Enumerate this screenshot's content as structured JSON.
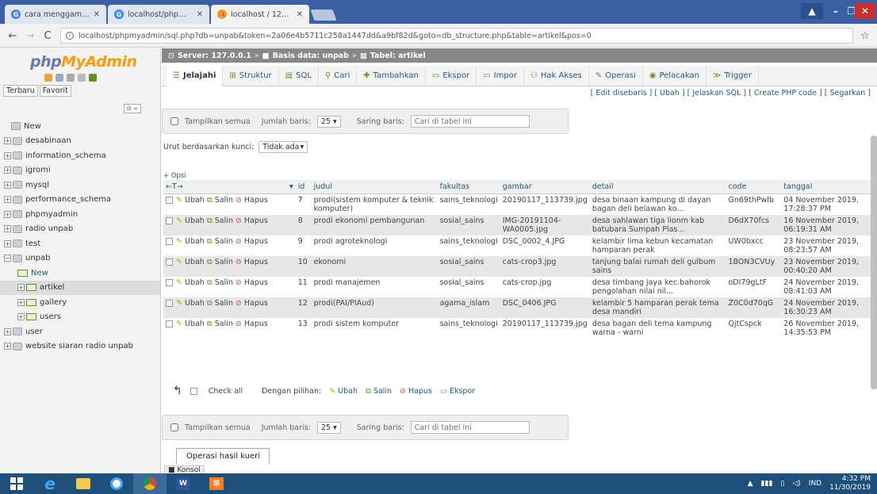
{
  "browser": {
    "tabs": [
      {
        "title": "cara menggambar lem - G...",
        "favicon": "google-icon",
        "active": false
      },
      {
        "title": "localhost/phpmyadmin - G",
        "favicon": "google-icon",
        "active": false
      },
      {
        "title": "localhost / 127.0.0.1 / ...",
        "favicon": "pma-icon",
        "active": true
      }
    ],
    "url": "localhost/phpmyadmin/sql.php?db=unpab&token=2a06e4b5711c258a1447dd&a9bf82d&goto=db_structure.php&table=artikel&pos=0"
  },
  "sidebar": {
    "logo_a": "php",
    "logo_b": "MyAdmin",
    "recent_label": "Terbaru",
    "favorite_label": "Favorit",
    "new_label": "New",
    "databases": [
      {
        "name": "desabinaan"
      },
      {
        "name": "information_schema"
      },
      {
        "name": "igromi"
      },
      {
        "name": "mysql"
      },
      {
        "name": "performance_schema"
      },
      {
        "name": "phpmyadmin"
      },
      {
        "name": "radio unpab"
      },
      {
        "name": "test"
      },
      {
        "name": "unpab"
      }
    ],
    "unpab_tables": [
      {
        "name": "New"
      },
      {
        "name": "artikel"
      },
      {
        "name": "gallery"
      },
      {
        "name": "users"
      }
    ],
    "more_databases": [
      {
        "name": "user"
      },
      {
        "name": "website siaran radio unpab"
      }
    ]
  },
  "breadcrumb": {
    "server": "Server: 127.0.0.1",
    "database": "Basis data: unpab",
    "table": "Tabel: artikel"
  },
  "menu": [
    {
      "label": "Jelajahi",
      "icon": "browse-icon"
    },
    {
      "label": "Struktur",
      "icon": "structure-icon"
    },
    {
      "label": "SQL",
      "icon": "sql-icon"
    },
    {
      "label": "Cari",
      "icon": "search-icon"
    },
    {
      "label": "Tambahkan",
      "icon": "insert-icon"
    },
    {
      "label": "Ekspor",
      "icon": "export-icon"
    },
    {
      "label": "Impor",
      "icon": "import-icon"
    },
    {
      "label": "Hak Akses",
      "icon": "privileges-icon"
    },
    {
      "label": "Operasi",
      "icon": "operations-icon"
    },
    {
      "label": "Pelacakan",
      "icon": "tracking-icon"
    },
    {
      "label": "Trigger",
      "icon": "trigger-icon"
    }
  ],
  "sublinks": "[ Edit disebaris ] [ Ubah ] [ Jelaskan SQL ] [ Create PHP code ] [ Segarkan ]",
  "nav": {
    "show_all": "Tampilkan semua",
    "rows_label": "Jumlah baris:",
    "rows_value": "25",
    "filter_label": "Saring baris:",
    "filter_placeholder": "Cari di tabel ini"
  },
  "sort": {
    "label": "Urut berdasarkan kunci:",
    "value": "Tidak ada"
  },
  "options_label": "+ Opsi",
  "columns": [
    "id",
    "judul",
    "fakultas",
    "gambar",
    "detail",
    "code",
    "tanggal"
  ],
  "actions": {
    "edit": "Ubah",
    "copy": "Salin",
    "delete": "Hapus"
  },
  "rows": [
    {
      "id": "7",
      "judul": "prodi(sistem komputer & teknik komputer)",
      "fakultas": "sains_teknologi",
      "gambar": "20190117_113739.jpg",
      "detail": "desa binaan kampung di dayan bagan deli belawan ko...",
      "code": "Gn69thPwlb",
      "tanggal": "04 November 2019, 17:28:37 PM"
    },
    {
      "id": "8",
      "judul": "prodi ekonomi pembangunan",
      "fakultas": "sosial_sains",
      "gambar": "IMG-20191104-WA0005.jpg",
      "detail": "desa sahlawan tiga lionm kab batubara Sumpah Plas...",
      "code": "D6dX70fcs",
      "tanggal": "16 November 2019, 06:19:31 AM"
    },
    {
      "id": "9",
      "judul": "prodi agroteknologi",
      "fakultas": "sains_teknologi",
      "gambar": "DSC_0002_4.JPG",
      "detail": "kelambir lima kebun kecamatan hamparan perak",
      "code": "UW0bxcc",
      "tanggal": "23 November 2019, 08:23:57 AM"
    },
    {
      "id": "10",
      "judul": "ekonomi",
      "fakultas": "sosial_sains",
      "gambar": "cats-crop3.jpg",
      "detail": "tanjung balai rumah deli gulbum sains",
      "code": "1BON3CVUy",
      "tanggal": "23 November 2019, 00:40:20 AM"
    },
    {
      "id": "11",
      "judul": "prodi manajemen",
      "fakultas": "sosial_sains",
      "gambar": "cats-crop.jpg",
      "detail": "desa timbang jaya kec.bahorok pengolahan nilai nil...",
      "code": "oDI79gLtF",
      "tanggal": "24 November 2019, 08:41:03 AM"
    },
    {
      "id": "12",
      "judul": "prodi(PAI/PIAud)",
      "fakultas": "agama_islam",
      "gambar": "DSC_0406.JPG",
      "detail": "kelambir 5 hamparan perak tema desa mandiri",
      "code": "Z0C0d70qG",
      "tanggal": "24 November 2019, 16:30:23 AM"
    },
    {
      "id": "13",
      "judul": "prodi sistem komputer",
      "fakultas": "sains_teknologi",
      "gambar": "20190117_113739.jpg",
      "detail": "desa bagan deli tema kampung warna - warni",
      "code": "QjtCspck",
      "tanggal": "26 November 2019, 14:35:53 PM"
    }
  ],
  "bulk": {
    "check_all": "Check all",
    "with_selected": "Dengan pilihan:",
    "edit": "Ubah",
    "copy": "Salin",
    "delete": "Hapus",
    "export": "Ekspor"
  },
  "result_ops": "Operasi hasil kueri",
  "console": "Konsol",
  "taskbar": {
    "lang": "IND",
    "time": "4:32 PM",
    "date": "11/30/2019"
  },
  "colors": {
    "tabstrip": "#3b5fa5",
    "taskbar": "#1e4e7a",
    "link": "#235a81",
    "logo_php": "#6c78af",
    "logo_admin": "#f89c0e"
  }
}
